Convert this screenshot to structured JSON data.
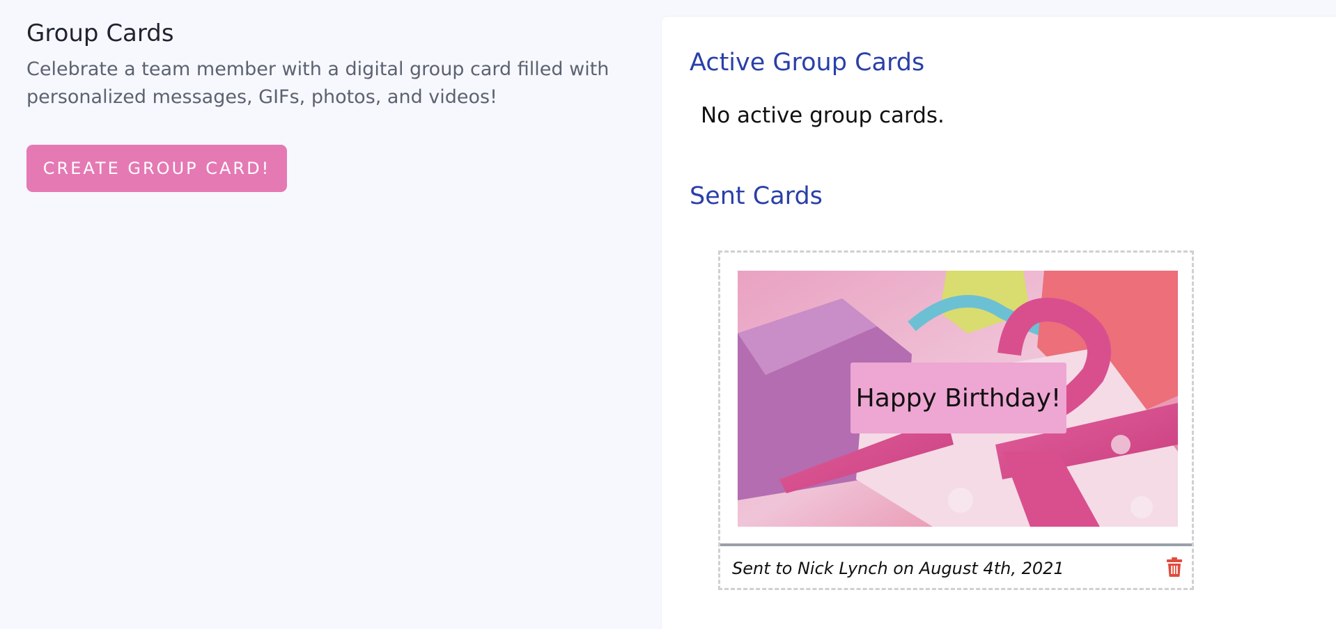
{
  "page": {
    "title": "Group Cards",
    "description": "Celebrate a team member with a digital group card filled with personalized messages, GIFs, photos, and videos!",
    "create_button": "CREATE GROUP CARD!"
  },
  "active": {
    "heading": "Active Group Cards",
    "empty_message": "No active group cards."
  },
  "sent": {
    "heading": "Sent Cards",
    "cards": [
      {
        "label": "Happy Birthday!",
        "footer": "Sent to Nick Lynch on August 4th, 2021",
        "delete_icon": "trash-icon"
      }
    ]
  },
  "colors": {
    "accent_pink": "#e579b4",
    "heading_blue": "#2a3fa8",
    "label_pink": "#eea6d2",
    "delete_red": "#e04b3c"
  }
}
